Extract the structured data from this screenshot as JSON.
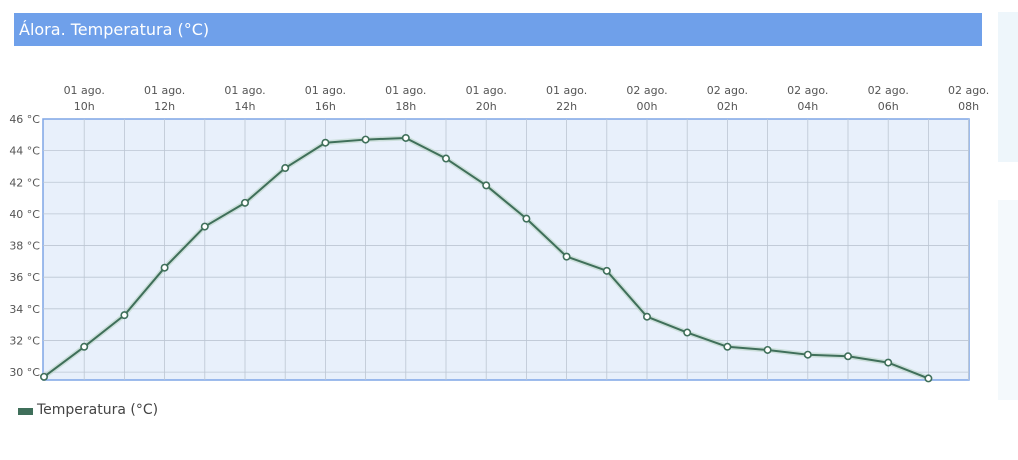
{
  "title": "Álora. Temperatura (°C)",
  "colors": {
    "title_bg": "#6fa0ea",
    "plot_bg": "#e8f0fb",
    "plot_border": "#7fa6e6",
    "grid": "#bcc6d3",
    "series": "#3f6f5a"
  },
  "legend": {
    "label": "Temperatura (°C)",
    "placement": "bottom-left"
  },
  "chart_data": {
    "type": "line",
    "title": "Álora. Temperatura (°C)",
    "x": [
      "01 ago. 09h",
      "01 ago. 10h",
      "01 ago. 11h",
      "01 ago. 12h",
      "01 ago. 13h",
      "01 ago. 14h",
      "01 ago. 15h",
      "01 ago. 16h",
      "01 ago. 17h",
      "01 ago. 18h",
      "01 ago. 19h",
      "01 ago. 20h",
      "01 ago. 21h",
      "01 ago. 22h",
      "01 ago. 23h",
      "02 ago. 00h",
      "02 ago. 01h",
      "02 ago. 02h",
      "02 ago. 03h",
      "02 ago. 04h",
      "02 ago. 05h",
      "02 ago. 06h",
      "02 ago. 07h"
    ],
    "series": [
      {
        "name": "Temperatura (°C)",
        "values": [
          29.7,
          31.6,
          33.6,
          36.6,
          39.2,
          40.7,
          42.9,
          44.5,
          44.7,
          44.8,
          43.5,
          41.8,
          39.7,
          37.3,
          36.4,
          33.5,
          32.5,
          31.6,
          31.4,
          31.1,
          31.0,
          30.6,
          29.6
        ]
      }
    ],
    "x_ticks": [
      {
        "date": "01 ago.",
        "hour": "10h"
      },
      {
        "date": "01 ago.",
        "hour": "12h"
      },
      {
        "date": "01 ago.",
        "hour": "14h"
      },
      {
        "date": "01 ago.",
        "hour": "16h"
      },
      {
        "date": "01 ago.",
        "hour": "18h"
      },
      {
        "date": "01 ago.",
        "hour": "20h"
      },
      {
        "date": "01 ago.",
        "hour": "22h"
      },
      {
        "date": "02 ago.",
        "hour": "00h"
      },
      {
        "date": "02 ago.",
        "hour": "02h"
      },
      {
        "date": "02 ago.",
        "hour": "04h"
      },
      {
        "date": "02 ago.",
        "hour": "06h"
      },
      {
        "date": "02 ago.",
        "hour": "08h"
      }
    ],
    "y_ticks": [
      "30 °C",
      "32 °C",
      "34 °C",
      "36 °C",
      "38 °C",
      "40 °C",
      "42 °C",
      "44 °C",
      "46 °C"
    ],
    "ylim": [
      29.5,
      46
    ],
    "grid": true
  }
}
